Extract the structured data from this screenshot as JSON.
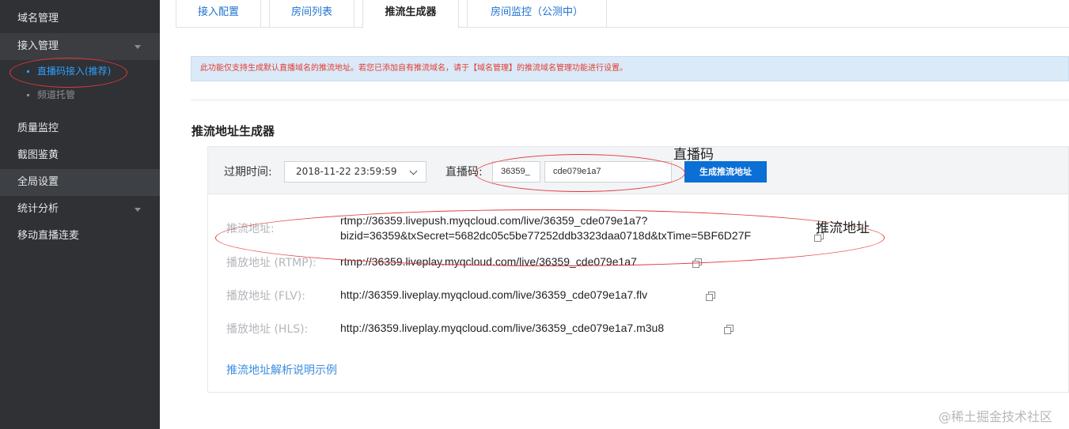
{
  "sidebar": {
    "items": [
      {
        "label": "域名管理"
      },
      {
        "label": "接入管理"
      },
      {
        "label": "质量监控"
      },
      {
        "label": "截图鉴黄"
      },
      {
        "label": "全局设置"
      },
      {
        "label": "统计分析"
      },
      {
        "label": "移动直播连麦"
      }
    ],
    "sub_items": [
      {
        "label": "直播码接入(推荐)"
      },
      {
        "label": "频道托管"
      }
    ]
  },
  "tabs": [
    {
      "label": "接入配置"
    },
    {
      "label": "房间列表"
    },
    {
      "label": "推流生成器"
    },
    {
      "label": "房间监控（公测中）"
    }
  ],
  "notice": "此功能仅支持生成默认直播域名的推流地址。若您已添加自有推流域名，请于【域名管理】的推流域名管理功能进行设置。",
  "section_title": "推流地址生成器",
  "form": {
    "expire_label": "过期时间:",
    "expire_value": "2018-11-22 23:59:59",
    "code_label": "直播码:",
    "code_prefix": "36359_",
    "code_value": "cde079e1a7",
    "generate_button": "生成推流地址"
  },
  "results": [
    {
      "label": "推流地址:",
      "value_line1": "rtmp://36359.livepush.myqcloud.com/live/36359_cde079e1a7?",
      "value_line2": "bizid=36359&txSecret=5682dc05c5be77252ddb3323daa0718d&txTime=5BF6D27F"
    },
    {
      "label": "播放地址 (RTMP):",
      "value": "rtmp://36359.liveplay.myqcloud.com/live/36359_cde079e1a7"
    },
    {
      "label": "播放地址 (FLV):",
      "value": "http://36359.liveplay.myqcloud.com/live/36359_cde079e1a7.flv"
    },
    {
      "label": "播放地址 (HLS):",
      "value": "http://36359.liveplay.myqcloud.com/live/36359_cde079e1a7.m3u8"
    }
  ],
  "help_link": "推流地址解析说明示例",
  "annotations": {
    "code_note": "直播码",
    "push_note": "推流地址"
  },
  "watermark": "@稀土掘金技术社区",
  "colors": {
    "sidebar_bg": "#2f3135",
    "accent": "#0b6fd6",
    "notice_text": "#e23b32",
    "annotation_red": "#e03a3a"
  }
}
